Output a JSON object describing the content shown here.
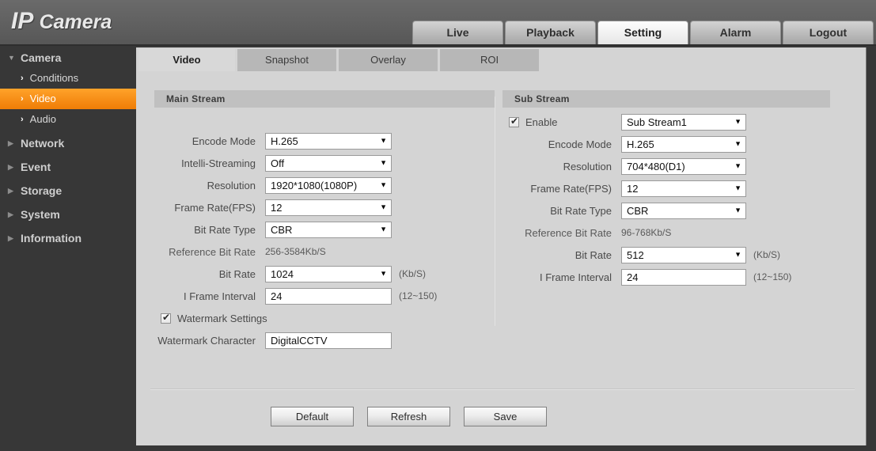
{
  "header": {
    "logo_bold": "IP",
    "logo_light": "Camera",
    "nav": [
      {
        "label": "Live",
        "active": false
      },
      {
        "label": "Playback",
        "active": false
      },
      {
        "label": "Setting",
        "active": true
      },
      {
        "label": "Alarm",
        "active": false
      },
      {
        "label": "Logout",
        "active": false
      }
    ]
  },
  "sidebar": {
    "items": [
      {
        "label": "Camera",
        "type": "group",
        "expanded": true,
        "icon": "triangle-down-icon"
      },
      {
        "label": "Conditions",
        "type": "sub",
        "active": false,
        "icon": "chevron-right-icon"
      },
      {
        "label": "Video",
        "type": "sub",
        "active": true,
        "icon": "chevron-right-icon"
      },
      {
        "label": "Audio",
        "type": "sub",
        "active": false,
        "icon": "chevron-right-icon"
      },
      {
        "label": "Network",
        "type": "group",
        "expanded": false,
        "icon": "triangle-right-icon"
      },
      {
        "label": "Event",
        "type": "group",
        "expanded": false,
        "icon": "triangle-right-icon"
      },
      {
        "label": "Storage",
        "type": "group",
        "expanded": false,
        "icon": "triangle-right-icon"
      },
      {
        "label": "System",
        "type": "group",
        "expanded": false,
        "icon": "triangle-right-icon"
      },
      {
        "label": "Information",
        "type": "group",
        "expanded": false,
        "icon": "triangle-right-icon"
      }
    ]
  },
  "tabs": [
    {
      "label": "Video",
      "active": true
    },
    {
      "label": "Snapshot",
      "active": false
    },
    {
      "label": "Overlay",
      "active": false
    },
    {
      "label": "ROI",
      "active": false
    }
  ],
  "main_stream": {
    "title": "Main Stream",
    "encode_mode": {
      "label": "Encode Mode",
      "value": "H.265"
    },
    "intelli_streaming": {
      "label": "Intelli-Streaming",
      "value": "Off"
    },
    "resolution": {
      "label": "Resolution",
      "value": "1920*1080(1080P)"
    },
    "frame_rate": {
      "label": "Frame Rate(FPS)",
      "value": "12"
    },
    "bit_rate_type": {
      "label": "Bit Rate Type",
      "value": "CBR"
    },
    "reference_bit_rate": {
      "label": "Reference Bit Rate",
      "value": "256-3584Kb/S"
    },
    "bit_rate": {
      "label": "Bit Rate",
      "value": "1024",
      "suffix": "(Kb/S)"
    },
    "i_frame_interval": {
      "label": "I Frame Interval",
      "value": "24",
      "suffix": "(12~150)"
    },
    "watermark_settings": {
      "label": "Watermark Settings",
      "checked": true
    },
    "watermark_character": {
      "label": "Watermark Character",
      "value": "DigitalCCTV"
    }
  },
  "sub_stream": {
    "title": "Sub Stream",
    "enable": {
      "label": "Enable",
      "checked": true,
      "value": "Sub Stream1"
    },
    "encode_mode": {
      "label": "Encode Mode",
      "value": "H.265"
    },
    "resolution": {
      "label": "Resolution",
      "value": "704*480(D1)"
    },
    "frame_rate": {
      "label": "Frame Rate(FPS)",
      "value": "12"
    },
    "bit_rate_type": {
      "label": "Bit Rate Type",
      "value": "CBR"
    },
    "reference_bit_rate": {
      "label": "Reference Bit Rate",
      "value": "96-768Kb/S"
    },
    "bit_rate": {
      "label": "Bit Rate",
      "value": "512",
      "suffix": "(Kb/S)"
    },
    "i_frame_interval": {
      "label": "I Frame Interval",
      "value": "24",
      "suffix": "(12~150)"
    }
  },
  "buttons": {
    "default": "Default",
    "refresh": "Refresh",
    "save": "Save"
  },
  "colors": {
    "accent_orange": "#f78f18",
    "sidebar_bg": "#373737",
    "content_bg": "#d4d4d4",
    "panel_head_bg": "#c0c0c0"
  }
}
